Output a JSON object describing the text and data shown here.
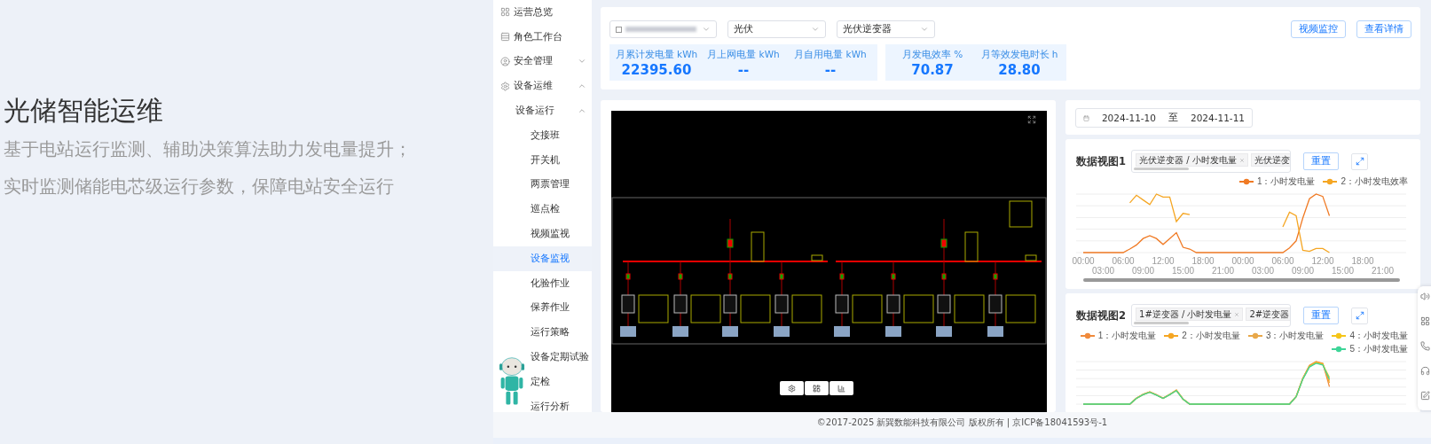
{
  "hero": {
    "title": "光储智能运维",
    "lines": [
      "基于电站运行监测、辅助决策算法助力发电量提升；",
      "实时监测储能电芯级运行参数，保障电站安全运行"
    ]
  },
  "sidebar": {
    "items": [
      {
        "label": "运营总览",
        "kind": "link"
      },
      {
        "label": "角色工作台",
        "kind": "link"
      },
      {
        "label": "安全管理",
        "kind": "group",
        "expanded": false
      },
      {
        "label": "设备运维",
        "kind": "group",
        "expanded": true,
        "children": [
          {
            "label": "设备运行",
            "kind": "group",
            "expanded": true,
            "children": [
              {
                "label": "交接班",
                "selected": false
              },
              {
                "label": "开关机",
                "selected": false
              },
              {
                "label": "两票管理",
                "selected": false
              },
              {
                "label": "巡点检",
                "selected": false
              },
              {
                "label": "视频监视",
                "selected": false
              },
              {
                "label": "设备监视",
                "selected": true
              },
              {
                "label": "化验作业",
                "selected": false
              },
              {
                "label": "保养作业",
                "selected": false
              },
              {
                "label": "运行策略",
                "selected": false
              },
              {
                "label": "设备定期试验",
                "selected": false
              },
              {
                "label": "定检",
                "selected": false
              },
              {
                "label": "运行分析",
                "selected": false
              }
            ]
          }
        ]
      }
    ]
  },
  "filters": [
    "光伏",
    "光伏逆变器"
  ],
  "actions": [
    "视频监控",
    "查看详情"
  ],
  "stat_groups": [
    [
      {
        "label": "月累计发电量 kWh",
        "value": "22395.60"
      },
      {
        "label": "月上网电量 kWh",
        "value": "--"
      },
      {
        "label": "月自用电量 kWh",
        "value": "--"
      }
    ],
    [
      {
        "label": "月发电效率 %",
        "value": "70.87"
      },
      {
        "label": "月等效发电时长 h",
        "value": "28.80"
      }
    ]
  ],
  "date_range": {
    "start": "2024-11-10",
    "separator": "至",
    "end": "2024-11-11"
  },
  "charts": [
    {
      "title": "数据视图1",
      "tags": [
        {
          "label": "光伏逆变器 / 小时发电量",
          "removable": true
        },
        {
          "label": "光伏逆变",
          "removable": false
        }
      ],
      "reset": "重置",
      "legend": [
        {
          "label": "1：小时发电量",
          "color": "#f07a24"
        },
        {
          "label": "2：小时发电效率",
          "color": "#f5a623"
        }
      ],
      "x_ticks": [
        "00:00",
        "03:00",
        "06:00",
        "09:00",
        "12:00",
        "15:00",
        "18:00",
        "21:00",
        "00:00",
        "03:00",
        "06:00",
        "09:00",
        "12:00",
        "15:00",
        "18:00",
        "21:00"
      ]
    },
    {
      "title": "数据视图2",
      "tags": [
        {
          "label": "1#逆变器 / 小时发电量",
          "removable": true
        },
        {
          "label": "2#逆变器",
          "removable": false
        }
      ],
      "reset": "重置",
      "legend": [
        {
          "label": "1：小时发电量",
          "color": "#f08a3c"
        },
        {
          "label": "2：小时发电量",
          "color": "#f5a623"
        },
        {
          "label": "3：小时发电量",
          "color": "#e8a84a"
        },
        {
          "label": "4：小时发电量",
          "color": "#f5c518"
        },
        {
          "label": "5：小时发电量",
          "color": "#3ed598"
        }
      ]
    }
  ],
  "footer": "©2017-2025 新巽数能科技有限公司 版权所有 | 京ICP备18041593号-1"
}
